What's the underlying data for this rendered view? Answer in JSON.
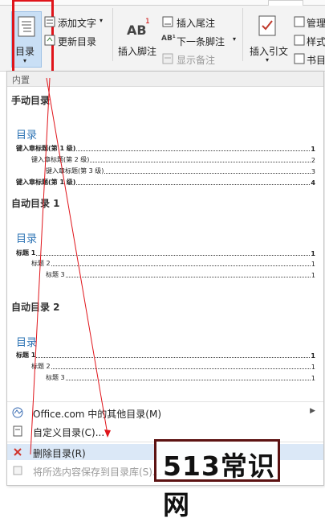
{
  "ribbon": {
    "toc_button": "目录",
    "add_text": "添加文字",
    "update_toc": "更新目录",
    "insert_footnote": "插入脚注",
    "footnote_ab": "AB",
    "footnote_sup": "1",
    "insert_endnote": "插入尾注",
    "next_footnote": "下一条脚注",
    "show_notes": "显示备注",
    "insert_citation": "插入引文",
    "manage": "管理",
    "style": "样式",
    "bibliography": "书目"
  },
  "panel": {
    "builtin_label": "内置",
    "manual": {
      "title": "手动目录",
      "heading": "目录",
      "lines": [
        {
          "text": "键入章标题(第 1 级)",
          "page": "1",
          "bold": true
        },
        {
          "text": "键入章标题(第 2 级)",
          "page": "2",
          "bold": false
        },
        {
          "text": "键入章标题(第 3 级)",
          "page": "3",
          "bold": false
        },
        {
          "text": "键入章标题(第 1 级)",
          "page": "4",
          "bold": true
        }
      ]
    },
    "auto1": {
      "title": "自动目录 1",
      "heading": "目录",
      "lines": [
        {
          "text": "标题 1",
          "page": "1"
        },
        {
          "text": "标题 2",
          "page": "1"
        },
        {
          "text": "标题 3",
          "page": "1"
        }
      ]
    },
    "auto2": {
      "title": "自动目录 2",
      "heading": "目录",
      "lines": [
        {
          "text": "标题 1",
          "page": "1"
        },
        {
          "text": "标题 2",
          "page": "1"
        },
        {
          "text": "标题 3",
          "page": "1"
        }
      ]
    },
    "menu": {
      "more_office": "Office.com 中的其他目录(M)",
      "custom_toc": "自定义目录(C)...",
      "remove_toc": "删除目录(R)",
      "save_selection": "将所选内容保存到目录库(S)..."
    }
  },
  "watermark": "513常识网",
  "colors": {
    "highlight": "#e0141a",
    "accent": "#2e74b5"
  }
}
